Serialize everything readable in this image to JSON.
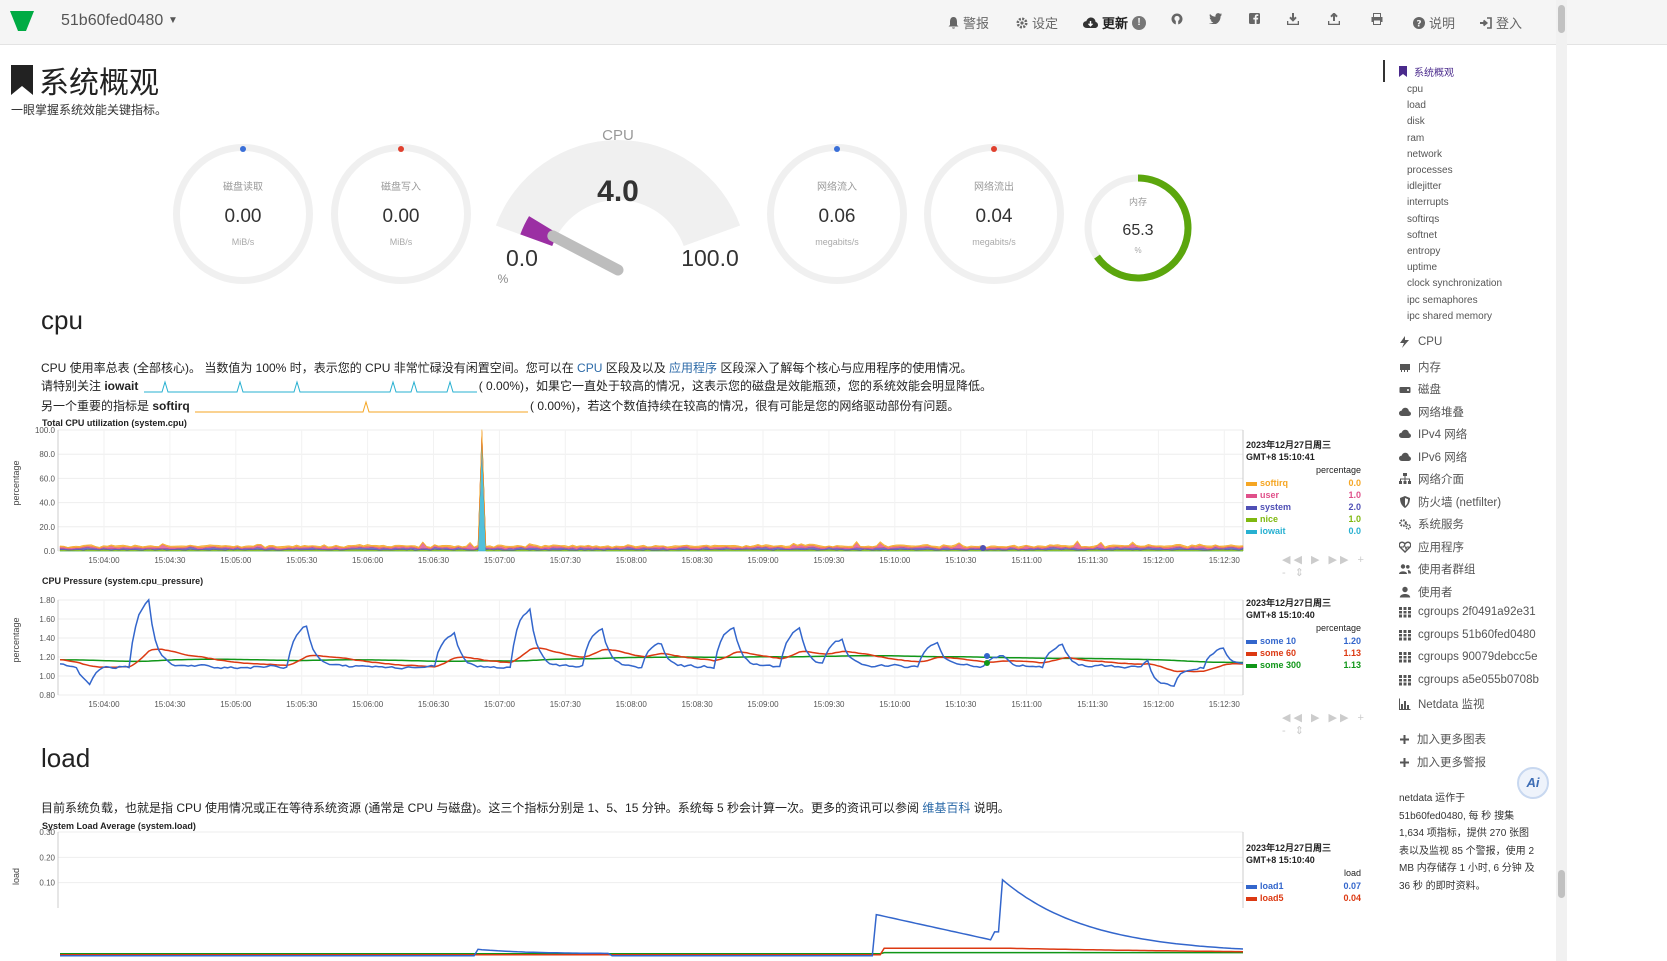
{
  "topbar": {
    "host": "51b60fed0480",
    "alarms": "警报",
    "settings": "设定",
    "update": "更新",
    "update_badge": "!",
    "help": "说明",
    "login": "登入"
  },
  "page": {
    "title": "系统概观",
    "subtitle": "一眼掌握系统效能关键指标。"
  },
  "gauges": [
    {
      "label": "磁盘读取",
      "value": "0.00",
      "unit": "MiB/s",
      "dot": "#3a6fd8"
    },
    {
      "label": "磁盘写入",
      "value": "0.00",
      "unit": "MiB/s",
      "dot": "#e0402e"
    },
    {
      "label": "网络流入",
      "value": "0.06",
      "unit": "megabits/s",
      "dot": "#3a6fd8"
    },
    {
      "label": "网络流出",
      "value": "0.04",
      "unit": "megabits/s",
      "dot": "#e0402e"
    }
  ],
  "cpu_gauge": {
    "title": "CPU",
    "value": "4.0",
    "min": "0.0",
    "max": "100.0",
    "unit": "%",
    "percent": 4
  },
  "ram_gauge": {
    "label": "内存",
    "value": "65.3",
    "unit": "%",
    "percent": 65.3,
    "color": "#5ba60d"
  },
  "cpu_section": {
    "heading": "cpu",
    "p1_a": "CPU 使用率总表 (全部核心)。 当数值为 100% 时，表示您的 CPU 非常忙碌没有闲置空间。您可以在 ",
    "p1_link1": "CPU",
    "p1_b": " 区段及以及 ",
    "p1_link2": "应用程序",
    "p1_c": " 区段深入了解每个核心与应用程序的使用情况。",
    "p2_a": "请特别关注 ",
    "p2_b": "iowait",
    "p2_c": "(      0.00%)，如果它一直处于较高的情况，这表示您的磁盘是效能瓶颈，您的系统效能会明显降低。",
    "p3_a": "另一个重要的指标是 ",
    "p3_b": "softirq",
    "p3_c": "(      0.00%)，若这个数值持续在较高的情况，很有可能是您的网络驱动部份有问题。"
  },
  "load_section": {
    "heading": "load",
    "p1_a": "目前系统负载，也就是指 CPU 使用情况或正在等待系统资源 (通常是 CPU 与磁盘)。这三个指标分别是 1、5、15 分钟。系统每 5 秒会计算一次。更多的资讯可以参阅 ",
    "p1_link": "维基百科",
    "p1_b": " 说明。"
  },
  "x_ticks": [
    "15:04:00",
    "15:04:30",
    "15:05:00",
    "15:05:30",
    "15:06:00",
    "15:06:30",
    "15:07:00",
    "15:07:30",
    "15:08:00",
    "15:08:30",
    "15:09:00",
    "15:09:30",
    "15:10:00",
    "15:10:30",
    "15:11:00",
    "15:11:30",
    "15:12:00",
    "15:12:30"
  ],
  "charts": {
    "cpu": {
      "title": "Total CPU utilization (system.cpu)",
      "ylabel": "percentage",
      "yticks": [
        "100.0",
        "80.0",
        "60.0",
        "40.0",
        "20.0",
        "0.0"
      ],
      "date": "2023年12月27日周三",
      "time": "GMT+8 15:10:41",
      "unit": "percentage",
      "series": [
        {
          "name": "softirq",
          "value": "0.0",
          "color": "#f5a623"
        },
        {
          "name": "user",
          "value": "1.0",
          "color": "#e0508a"
        },
        {
          "name": "system",
          "value": "2.0",
          "color": "#4f4fb5"
        },
        {
          "name": "nice",
          "value": "1.0",
          "color": "#7fb80f"
        },
        {
          "name": "iowait",
          "value": "0.0",
          "color": "#27b0d1"
        }
      ]
    },
    "pressure": {
      "title": "CPU Pressure (system.cpu_pressure)",
      "ylabel": "percentage",
      "yticks": [
        "1.80",
        "1.60",
        "1.40",
        "1.20",
        "1.00",
        "0.80"
      ],
      "date": "2023年12月27日周三",
      "time": "GMT+8 15:10:40",
      "unit": "percentage",
      "series": [
        {
          "name": "some 10",
          "value": "1.20",
          "color": "#3366cc"
        },
        {
          "name": "some 60",
          "value": "1.13",
          "color": "#dc3912"
        },
        {
          "name": "some 300",
          "value": "1.13",
          "color": "#109618"
        }
      ]
    },
    "load": {
      "title": "System Load Average (system.load)",
      "ylabel": "load",
      "yticks": [
        "0.30",
        "0.20",
        "0.10"
      ],
      "date": "2023年12月27日周三",
      "time": "GMT+8 15:10:40",
      "unit": "load",
      "series": [
        {
          "name": "load1",
          "value": "0.07",
          "color": "#3366cc"
        },
        {
          "name": "load5",
          "value": "0.04",
          "color": "#dc3912"
        }
      ]
    }
  },
  "sidebar": {
    "active": "系统概观",
    "subs": [
      "cpu",
      "load",
      "disk",
      "ram",
      "network",
      "processes",
      "idlejitter",
      "interrupts",
      "softirqs",
      "softnet",
      "entropy",
      "uptime",
      "clock synchronization",
      "ipc semaphores",
      "ipc shared memory"
    ],
    "sections": [
      {
        "label": "CPU",
        "icon": "bolt-icon"
      },
      {
        "label": "内存",
        "icon": "memory-icon"
      },
      {
        "label": "磁盘",
        "icon": "hdd-icon"
      },
      {
        "label": "网络堆叠",
        "icon": "cloud-icon"
      },
      {
        "label": "IPv4 网络",
        "icon": "cloud-icon"
      },
      {
        "label": "IPv6 网络",
        "icon": "cloud-icon"
      },
      {
        "label": "网络介面",
        "icon": "sitemap-icon"
      },
      {
        "label": "防火墙 (netfilter)",
        "icon": "shield-icon"
      },
      {
        "label": "系统服务",
        "icon": "cogs-icon"
      },
      {
        "label": "应用程序",
        "icon": "heartbeat-icon"
      },
      {
        "label": "使用者群组",
        "icon": "users-icon"
      },
      {
        "label": "使用者",
        "icon": "user-icon"
      },
      {
        "label": "cgroups 2f0491a92e31",
        "icon": "grid-icon"
      },
      {
        "label": "cgroups 51b60fed0480",
        "icon": "grid-icon"
      },
      {
        "label": "cgroups 90079debcc5e",
        "icon": "grid-icon"
      },
      {
        "label": "cgroups a5e055b0708b",
        "icon": "grid-icon"
      },
      {
        "label": "Netdata 监视",
        "icon": "bar-chart-icon"
      }
    ],
    "add_charts": "加入更多图表",
    "add_alarms": "加入更多警报",
    "footer": [
      "netdata 运作于",
      "51b60fed0480, 每 秒 搜集",
      "1,634 项指标，提供 270 张图",
      "表以及监视 85 个警报，使用 2",
      "MB 内存储存 1 小时, 6 分钟 及",
      "36 秒 的即时资料。"
    ],
    "ai_label": "Ai"
  }
}
